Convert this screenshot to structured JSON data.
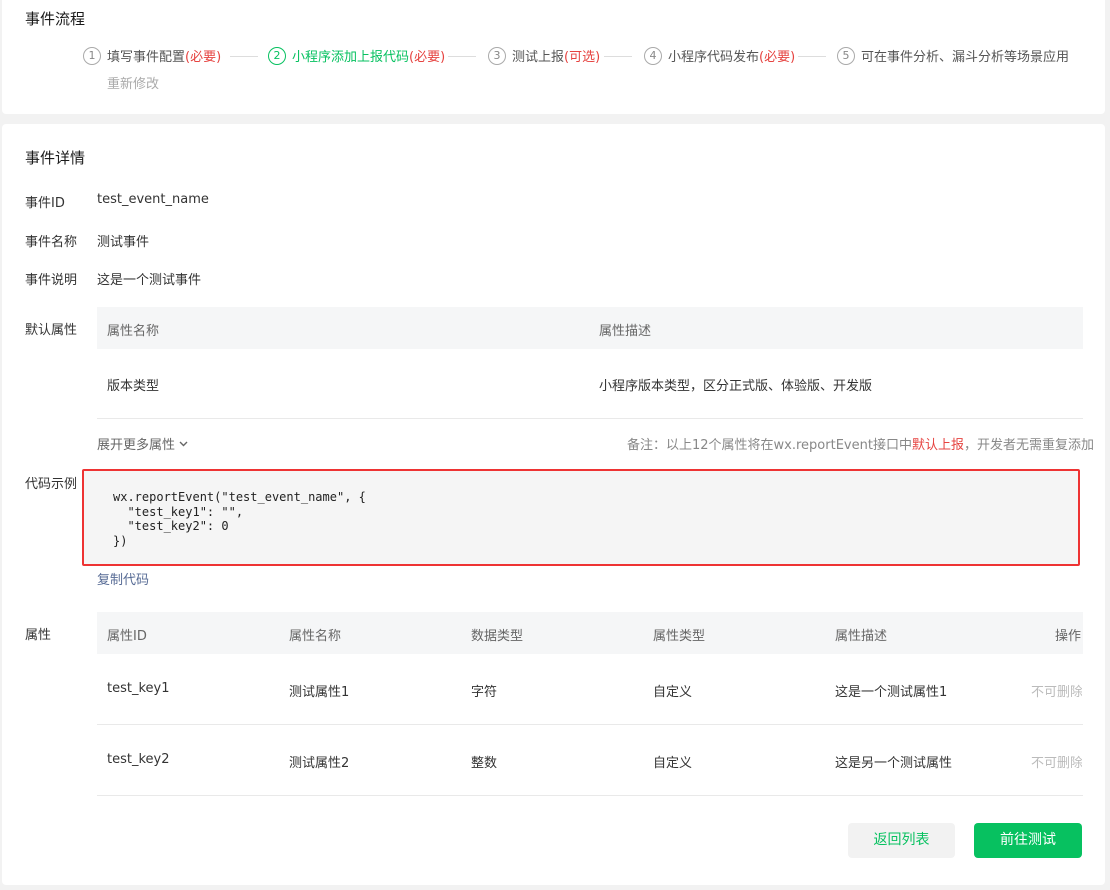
{
  "flow": {
    "title": "事件流程",
    "steps": [
      {
        "num": "1",
        "label": "填写事件配置 ",
        "tag": "(必要)"
      },
      {
        "num": "2",
        "label": "小程序添加上报代码",
        "tag": "(必要)"
      },
      {
        "num": "3",
        "label": "测试上报",
        "tag": "(可选)"
      },
      {
        "num": "4",
        "label": "小程序代码发布",
        "tag": "(必要)"
      },
      {
        "num": "5",
        "label": "可在事件分析、漏斗分析等场景应用",
        "tag": ""
      }
    ],
    "edit_link": "重新修改"
  },
  "detail": {
    "title": "事件详情",
    "event_id_label": "事件ID",
    "event_id": "test_event_name",
    "event_name_label": "事件名称",
    "event_name": "测试事件",
    "event_desc_label": "事件说明",
    "event_desc": "这是一个测试事件",
    "default_attrs_label": "默认属性",
    "default_table": {
      "headers": [
        "属性名称",
        "属性描述"
      ],
      "rows": [
        [
          "版本类型",
          "小程序版本类型，区分正式版、体验版、开发版"
        ]
      ]
    },
    "expand_more": "展开更多属性",
    "note_prefix": "备注：以上12个属性将在wx.reportEvent接口中",
    "note_highlight": "默认上报",
    "note_suffix": "，开发者无需重复添加",
    "code_label": "代码示例",
    "code": "wx.reportEvent(\"test_event_name\", {\n  \"test_key1\": \"\",\n  \"test_key2\": 0\n})",
    "copy_code": "复制代码",
    "attrs_label": "属性",
    "attr_table": {
      "headers": [
        "属性ID",
        "属性名称",
        "数据类型",
        "属性类型",
        "属性描述",
        "操作"
      ],
      "rows": [
        [
          "test_key1",
          "测试属性1",
          "字符",
          "自定义",
          "这是一个测试属性1",
          "不可删除"
        ],
        [
          "test_key2",
          "测试属性2",
          "整数",
          "自定义",
          "这是另一个测试属性",
          "不可删除"
        ]
      ]
    },
    "back_button": "返回列表",
    "test_button": "前往测试"
  }
}
